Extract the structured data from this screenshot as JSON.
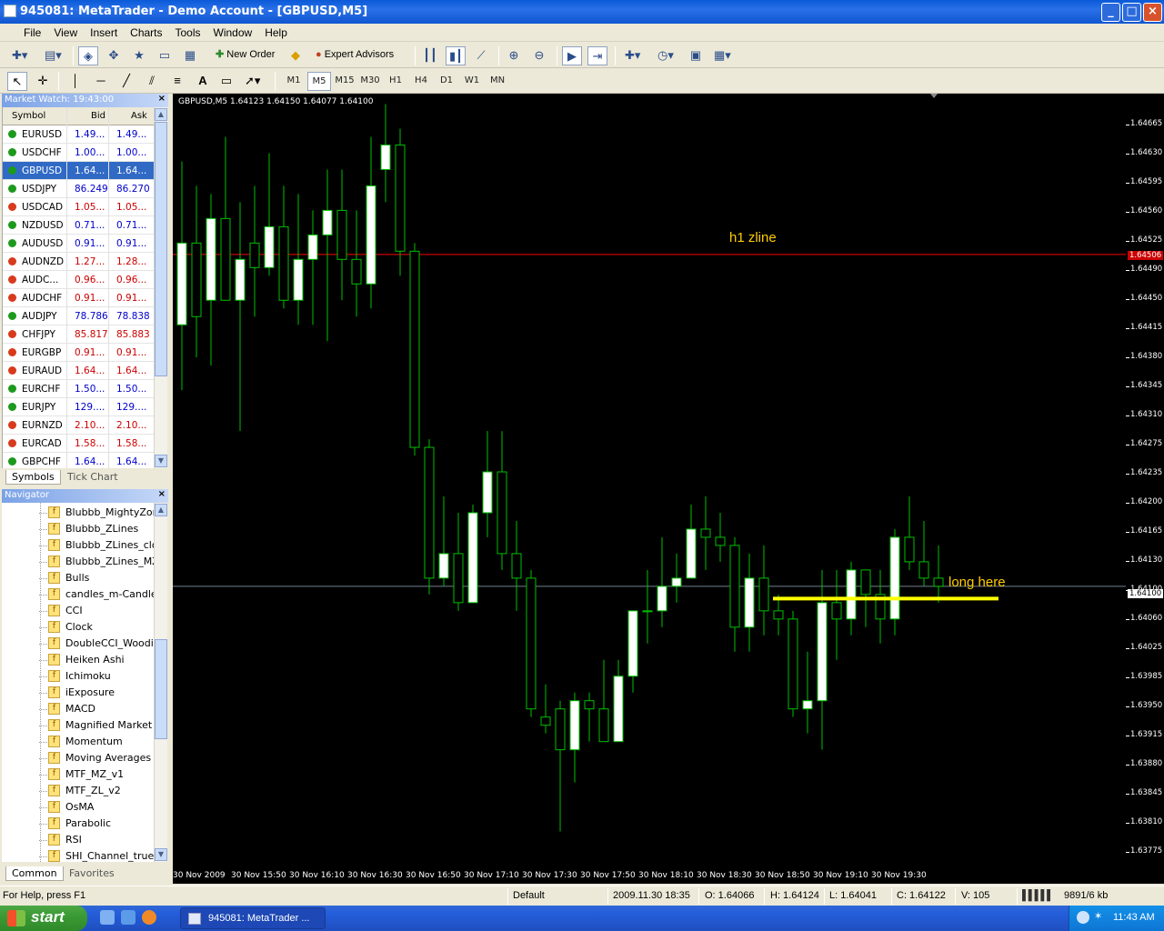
{
  "window": {
    "title": "945081: MetaTrader - Demo Account - [GBPUSD,M5]"
  },
  "menu": [
    "File",
    "View",
    "Insert",
    "Charts",
    "Tools",
    "Window",
    "Help"
  ],
  "toolbar": {
    "new_order": "New Order",
    "expert_advisors": "Expert Advisors"
  },
  "timeframes": [
    "M1",
    "M5",
    "M15",
    "M30",
    "H1",
    "H4",
    "D1",
    "W1",
    "MN"
  ],
  "active_timeframe": "M5",
  "market_watch": {
    "title": "Market Watch: 19:43:00",
    "headers": {
      "symbol": "Symbol",
      "bid": "Bid",
      "ask": "Ask"
    },
    "rows": [
      {
        "symbol": "EURUSD",
        "bid": "1.49...",
        "ask": "1.49...",
        "dir": "up"
      },
      {
        "symbol": "USDCHF",
        "bid": "1.00...",
        "ask": "1.00...",
        "dir": "up"
      },
      {
        "symbol": "GBPUSD",
        "bid": "1.64...",
        "ask": "1.64...",
        "dir": "up",
        "selected": true
      },
      {
        "symbol": "USDJPY",
        "bid": "86.249",
        "ask": "86.270",
        "dir": "up"
      },
      {
        "symbol": "USDCAD",
        "bid": "1.05...",
        "ask": "1.05...",
        "dir": "down"
      },
      {
        "symbol": "NZDUSD",
        "bid": "0.71...",
        "ask": "0.71...",
        "dir": "up"
      },
      {
        "symbol": "AUDUSD",
        "bid": "0.91...",
        "ask": "0.91...",
        "dir": "up"
      },
      {
        "symbol": "AUDNZD",
        "bid": "1.27...",
        "ask": "1.28...",
        "dir": "down"
      },
      {
        "symbol": "AUDC...",
        "bid": "0.96...",
        "ask": "0.96...",
        "dir": "down"
      },
      {
        "symbol": "AUDCHF",
        "bid": "0.91...",
        "ask": "0.91...",
        "dir": "down"
      },
      {
        "symbol": "AUDJPY",
        "bid": "78.786",
        "ask": "78.838",
        "dir": "up"
      },
      {
        "symbol": "CHFJPY",
        "bid": "85.817",
        "ask": "85.883",
        "dir": "down"
      },
      {
        "symbol": "EURGBP",
        "bid": "0.91...",
        "ask": "0.91...",
        "dir": "down"
      },
      {
        "symbol": "EURAUD",
        "bid": "1.64...",
        "ask": "1.64...",
        "dir": "down"
      },
      {
        "symbol": "EURCHF",
        "bid": "1.50...",
        "ask": "1.50...",
        "dir": "up"
      },
      {
        "symbol": "EURJPY",
        "bid": "129....",
        "ask": "129....",
        "dir": "up"
      },
      {
        "symbol": "EURNZD",
        "bid": "2.10...",
        "ask": "2.10...",
        "dir": "down"
      },
      {
        "symbol": "EURCAD",
        "bid": "1.58...",
        "ask": "1.58...",
        "dir": "down"
      },
      {
        "symbol": "GBPCHF",
        "bid": "1.64...",
        "ask": "1.64...",
        "dir": "up"
      }
    ],
    "tabs": [
      "Symbols",
      "Tick Chart"
    ]
  },
  "navigator": {
    "title": "Navigator",
    "items": [
      "Blubbb_MightyZone",
      "Blubbb_ZLines",
      "Blubbb_ZLines_clos",
      "Blubbb_ZLines_MZ_",
      "Bulls",
      "candles_m-Candles_",
      "CCI",
      "Clock",
      "DoubleCCI_Woodie",
      "Heiken Ashi",
      "Ichimoku",
      "iExposure",
      "MACD",
      "Magnified Market Pr",
      "Momentum",
      "Moving Averages",
      "MTF_MZ_v1",
      "MTF_ZL_v2",
      "OsMA",
      "Parabolic",
      "RSI",
      "SHI_Channel_true"
    ],
    "tabs": [
      "Common",
      "Favorites"
    ]
  },
  "chart": {
    "info": "GBPUSD,M5  1.64123 1.64150 1.64077 1.64100",
    "price_labels": [
      "1.64665",
      "1.64630",
      "1.64595",
      "1.64560",
      "1.64525",
      "1.64490",
      "1.64450",
      "1.64415",
      "1.64380",
      "1.64345",
      "1.64310",
      "1.64275",
      "1.64235",
      "1.64200",
      "1.64165",
      "1.64130",
      "1.64100",
      "1.64060",
      "1.64025",
      "1.63985",
      "1.63950",
      "1.63915",
      "1.63880",
      "1.63845",
      "1.63810",
      "1.63775"
    ],
    "h1_line_price": "1.64506",
    "current_price": "1.64100",
    "time_labels": [
      "30 Nov 2009",
      "30 Nov 15:50",
      "30 Nov 16:10",
      "30 Nov 16:30",
      "30 Nov 16:50",
      "30 Nov 17:10",
      "30 Nov 17:30",
      "30 Nov 17:50",
      "30 Nov 18:10",
      "30 Nov 18:30",
      "30 Nov 18:50",
      "30 Nov 19:10",
      "30 Nov 19:30"
    ],
    "annotations": {
      "zline": "h1 zline",
      "long": "long here"
    },
    "colors": {
      "bg": "#000000",
      "bull": "#ffffff",
      "wick": "#00c000",
      "zline": "#ff0000",
      "bid_line": "#708090",
      "long_line": "#ffff00",
      "text_yellow": "#ffcc00"
    }
  },
  "chart_data": {
    "type": "candlestick",
    "title": "GBPUSD,M5",
    "ylim": [
      1.63775,
      1.64665
    ],
    "candles": [
      {
        "o": 1.6442,
        "h": 1.6462,
        "l": 1.6434,
        "c": 1.6452
      },
      {
        "o": 1.6452,
        "h": 1.6459,
        "l": 1.6438,
        "c": 1.6443
      },
      {
        "o": 1.6445,
        "h": 1.6458,
        "l": 1.6437,
        "c": 1.6455
      },
      {
        "o": 1.6455,
        "h": 1.6465,
        "l": 1.6445,
        "c": 1.6445
      },
      {
        "o": 1.6445,
        "h": 1.6457,
        "l": 1.6429,
        "c": 1.645
      },
      {
        "o": 1.6452,
        "h": 1.6459,
        "l": 1.6443,
        "c": 1.6449
      },
      {
        "o": 1.6449,
        "h": 1.6463,
        "l": 1.6448,
        "c": 1.6454
      },
      {
        "o": 1.6454,
        "h": 1.6459,
        "l": 1.6444,
        "c": 1.6445
      },
      {
        "o": 1.6445,
        "h": 1.6458,
        "l": 1.6442,
        "c": 1.645
      },
      {
        "o": 1.645,
        "h": 1.6456,
        "l": 1.6442,
        "c": 1.6453
      },
      {
        "o": 1.6453,
        "h": 1.6461,
        "l": 1.644,
        "c": 1.6456
      },
      {
        "o": 1.6456,
        "h": 1.6461,
        "l": 1.6445,
        "c": 1.645
      },
      {
        "o": 1.645,
        "h": 1.6456,
        "l": 1.6443,
        "c": 1.6447
      },
      {
        "o": 1.6447,
        "h": 1.6465,
        "l": 1.6444,
        "c": 1.6459
      },
      {
        "o": 1.6461,
        "h": 1.6469,
        "l": 1.6457,
        "c": 1.6464
      },
      {
        "o": 1.6464,
        "h": 1.6466,
        "l": 1.6448,
        "c": 1.6451
      },
      {
        "o": 1.6451,
        "h": 1.6452,
        "l": 1.6426,
        "c": 1.6427
      },
      {
        "o": 1.6427,
        "h": 1.6428,
        "l": 1.6409,
        "c": 1.6411
      },
      {
        "o": 1.6411,
        "h": 1.6421,
        "l": 1.641,
        "c": 1.6414
      },
      {
        "o": 1.6414,
        "h": 1.6419,
        "l": 1.6407,
        "c": 1.6408
      },
      {
        "o": 1.6408,
        "h": 1.642,
        "l": 1.6408,
        "c": 1.6419
      },
      {
        "o": 1.6419,
        "h": 1.6429,
        "l": 1.6416,
        "c": 1.6424
      },
      {
        "o": 1.6424,
        "h": 1.6429,
        "l": 1.6412,
        "c": 1.6414
      },
      {
        "o": 1.6414,
        "h": 1.6418,
        "l": 1.6407,
        "c": 1.6411
      },
      {
        "o": 1.6411,
        "h": 1.6412,
        "l": 1.6394,
        "c": 1.6395
      },
      {
        "o": 1.6394,
        "h": 1.6398,
        "l": 1.6392,
        "c": 1.6393
      },
      {
        "o": 1.6395,
        "h": 1.6396,
        "l": 1.638,
        "c": 1.639
      },
      {
        "o": 1.639,
        "h": 1.6397,
        "l": 1.6386,
        "c": 1.6396
      },
      {
        "o": 1.6396,
        "h": 1.6397,
        "l": 1.6391,
        "c": 1.6395
      },
      {
        "o": 1.6395,
        "h": 1.6401,
        "l": 1.6391,
        "c": 1.6391
      },
      {
        "o": 1.6391,
        "h": 1.6401,
        "l": 1.6391,
        "c": 1.6399
      },
      {
        "o": 1.6399,
        "h": 1.6407,
        "l": 1.6397,
        "c": 1.6407
      },
      {
        "o": 1.6407,
        "h": 1.6412,
        "l": 1.6403,
        "c": 1.6407
      },
      {
        "o": 1.6407,
        "h": 1.6416,
        "l": 1.6405,
        "c": 1.641
      },
      {
        "o": 1.641,
        "h": 1.6414,
        "l": 1.6408,
        "c": 1.6411
      },
      {
        "o": 1.6411,
        "h": 1.642,
        "l": 1.6411,
        "c": 1.6417
      },
      {
        "o": 1.6417,
        "h": 1.6421,
        "l": 1.6412,
        "c": 1.6416
      },
      {
        "o": 1.6416,
        "h": 1.6419,
        "l": 1.6413,
        "c": 1.6415
      },
      {
        "o": 1.6415,
        "h": 1.6416,
        "l": 1.6402,
        "c": 1.6405
      },
      {
        "o": 1.6405,
        "h": 1.6414,
        "l": 1.6402,
        "c": 1.6411
      },
      {
        "o": 1.6411,
        "h": 1.6415,
        "l": 1.6404,
        "c": 1.6407
      },
      {
        "o": 1.6407,
        "h": 1.6409,
        "l": 1.6404,
        "c": 1.6406
      },
      {
        "o": 1.6406,
        "h": 1.6407,
        "l": 1.6394,
        "c": 1.6395
      },
      {
        "o": 1.6395,
        "h": 1.6402,
        "l": 1.6392,
        "c": 1.6396
      },
      {
        "o": 1.6396,
        "h": 1.6412,
        "l": 1.639,
        "c": 1.6408
      },
      {
        "o": 1.6408,
        "h": 1.6412,
        "l": 1.6401,
        "c": 1.6406
      },
      {
        "o": 1.6406,
        "h": 1.6413,
        "l": 1.6404,
        "c": 1.6412
      },
      {
        "o": 1.6412,
        "h": 1.6411,
        "l": 1.6405,
        "c": 1.6409
      },
      {
        "o": 1.6409,
        "h": 1.6412,
        "l": 1.6403,
        "c": 1.6406
      },
      {
        "o": 1.6406,
        "h": 1.6417,
        "l": 1.6404,
        "c": 1.6416
      },
      {
        "o": 1.6416,
        "h": 1.6421,
        "l": 1.6412,
        "c": 1.6413
      },
      {
        "o": 1.6413,
        "h": 1.6418,
        "l": 1.641,
        "c": 1.6411
      },
      {
        "o": 1.6411,
        "h": 1.6415,
        "l": 1.6408,
        "c": 1.641
      }
    ]
  },
  "status": {
    "help": "For Help, press F1",
    "profile": "Default",
    "datetime": "2009.11.30 18:35",
    "open": "O: 1.64066",
    "high": "H: 1.64124",
    "low": "L: 1.64041",
    "close": "C: 1.64122",
    "volume": "V: 105",
    "traffic": "9891/6 kb"
  },
  "taskbar": {
    "start": "start",
    "task": "945081: MetaTrader ...",
    "clock": "11:43 AM"
  }
}
